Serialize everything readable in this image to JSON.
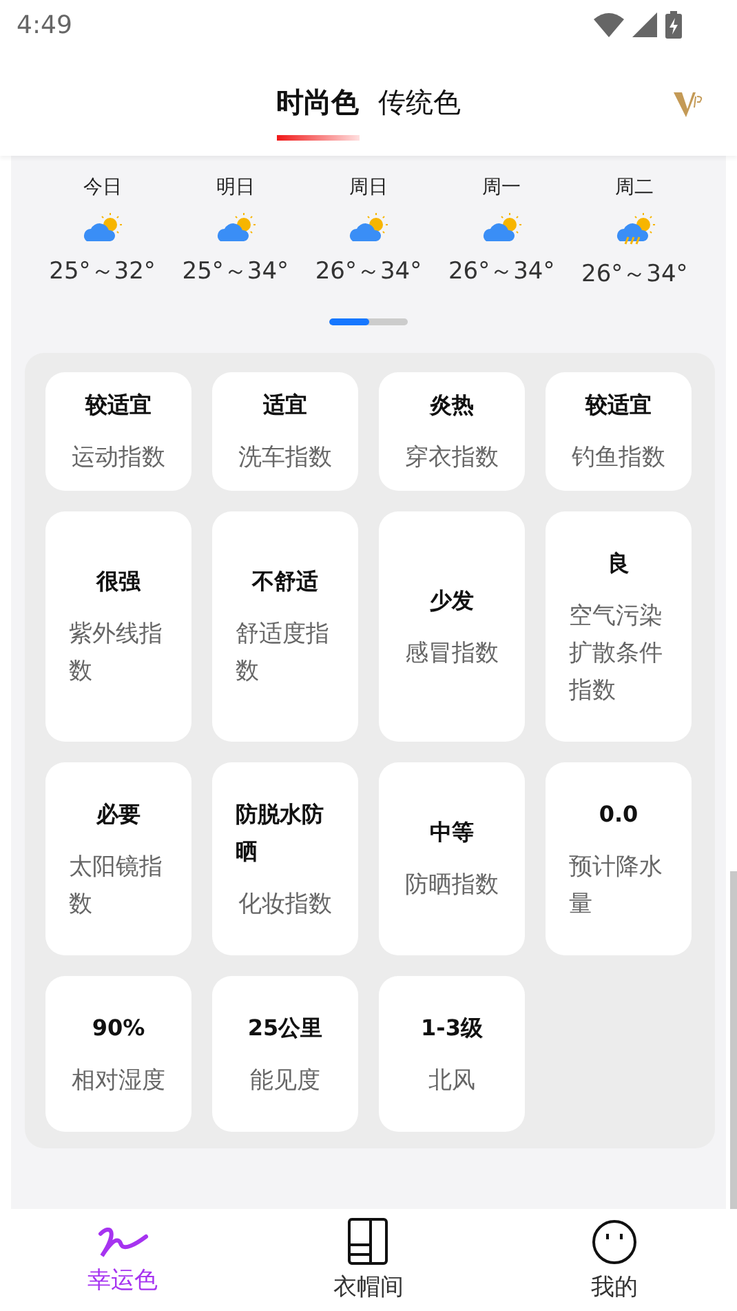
{
  "status_bar": {
    "time": "4:49"
  },
  "tabs": [
    {
      "label": "时尚色",
      "selected": true
    },
    {
      "label": "传统色",
      "selected": false
    }
  ],
  "forecast": {
    "days": [
      {
        "day": "今日",
        "kind": "cloudy",
        "temp": "25°～32°"
      },
      {
        "day": "明日",
        "kind": "cloudy",
        "temp": "25°～34°"
      },
      {
        "day": "周日",
        "kind": "cloudy",
        "temp": "26°～34°"
      },
      {
        "day": "周一",
        "kind": "cloudy",
        "temp": "26°～34°"
      },
      {
        "day": "周二",
        "kind": "shower",
        "temp": "26°～34°"
      }
    ],
    "pager": {
      "level": 0.5
    }
  },
  "indices": [
    [
      {
        "value": "较适宜",
        "label": "运动指数"
      },
      {
        "value": "适宜",
        "label": "洗车指数"
      },
      {
        "value": "炎热",
        "label": "穿衣指数"
      },
      {
        "value": "较适宜",
        "label": "钓鱼指数"
      }
    ],
    [
      {
        "value": "很强",
        "label": "紫外线指数"
      },
      {
        "value": "不舒适",
        "label": "舒适度指数"
      },
      {
        "value": "少发",
        "label": "感冒指数"
      },
      {
        "value": "良",
        "label": "空气污染扩散条件指数"
      }
    ],
    [
      {
        "value": "必要",
        "label": "太阳镜指数"
      },
      {
        "value": "防脱水防晒",
        "label": "化妆指数"
      },
      {
        "value": "中等",
        "label": "防晒指数"
      },
      {
        "value": "0.0",
        "label": "预计降水量"
      }
    ],
    [
      {
        "value": "90%",
        "label": "相对湿度"
      },
      {
        "value": "25公里",
        "label": "能见度"
      },
      {
        "value": "1-3级",
        "label": "北风"
      }
    ]
  ],
  "bottom_nav": [
    {
      "label": "幸运色",
      "selected": true
    },
    {
      "label": "衣帽间",
      "selected": false
    },
    {
      "label": "我的",
      "selected": false
    }
  ]
}
